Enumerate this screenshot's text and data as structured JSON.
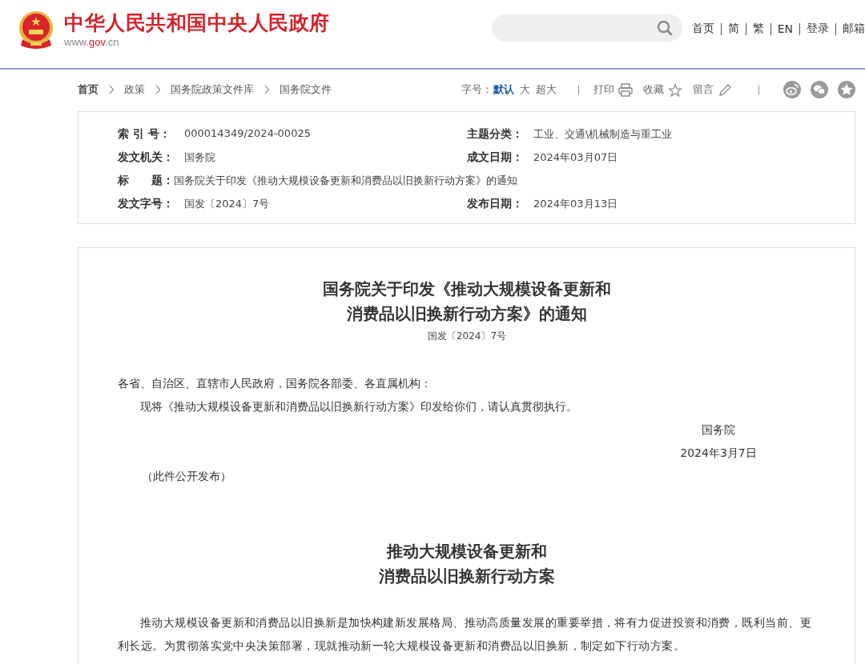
{
  "header": {
    "site_title": "中华人民共和国中央人民政府",
    "site_url": {
      "prefix": "www.",
      "domain": "gov",
      "suffix": ".cn"
    }
  },
  "top_nav": [
    "首页",
    "简",
    "繁",
    "EN",
    "登录",
    "邮箱"
  ],
  "breadcrumb": [
    "首页",
    "政策",
    "国务院政策文件库",
    "国务院文件"
  ],
  "font_size": {
    "label": "字号：",
    "options": [
      {
        "label": "默认",
        "selected": true
      },
      {
        "label": "大",
        "selected": false
      },
      {
        "label": "超大",
        "selected": false
      }
    ]
  },
  "actions": [
    {
      "label": "打印",
      "kind": "print"
    },
    {
      "label": "收藏",
      "kind": "favorite"
    },
    {
      "label": "留言",
      "kind": "comment"
    }
  ],
  "share_buttons": [
    {
      "kind": "weibo"
    },
    {
      "kind": "wechat"
    },
    {
      "kind": "qzone"
    }
  ],
  "metadata": [
    {
      "label": "索 引 号：",
      "value": "000014349/2024-00025",
      "right_label": "主题分类：",
      "right_value": "工业、交通\\机械制造与重工业"
    },
    {
      "label": "发文机关：",
      "value": "国务院",
      "right_label": "成文日期：",
      "right_value": "2024年03月07日"
    },
    {
      "label": "标　　题：",
      "value": "国务院关于印发《推动大规模设备更新和消费品以旧换新行动方案》的通知"
    },
    {
      "label": "发文字号：",
      "value": "国发〔2024〕7号",
      "right_label": "发布日期：",
      "right_value": "2024年03月13日"
    }
  ],
  "document": {
    "title_lines": [
      "国务院关于印发《推动大规模设备更新和",
      "消费品以旧换新行动方案》的通知"
    ],
    "doc_number": "国发〔2024〕7号",
    "salutation": "各省、自治区、直辖市人民政府，国务院各部委、各直属机构：",
    "body": "现将《推动大规模设备更新和消费品以旧换新行动方案》印发给你们，请认真贯彻执行。",
    "signature": "国务院",
    "date": "2024年3月7日",
    "note": "（此件公开发布）",
    "plan_title_lines": [
      "推动大规模设备更新和",
      "消费品以旧换新行动方案"
    ],
    "plan_paragraphs": [
      "推动大规模设备更新和消费品以旧换新是加快构建新发展格局、推动高质量发展的重要举措，将有力促进投资和消费，既利当前、更利长远。为贯彻落实党中央决策部署，现就推动新一轮大规模设备更新和消费品以旧换新，制定如下行动方案。"
    ]
  }
}
